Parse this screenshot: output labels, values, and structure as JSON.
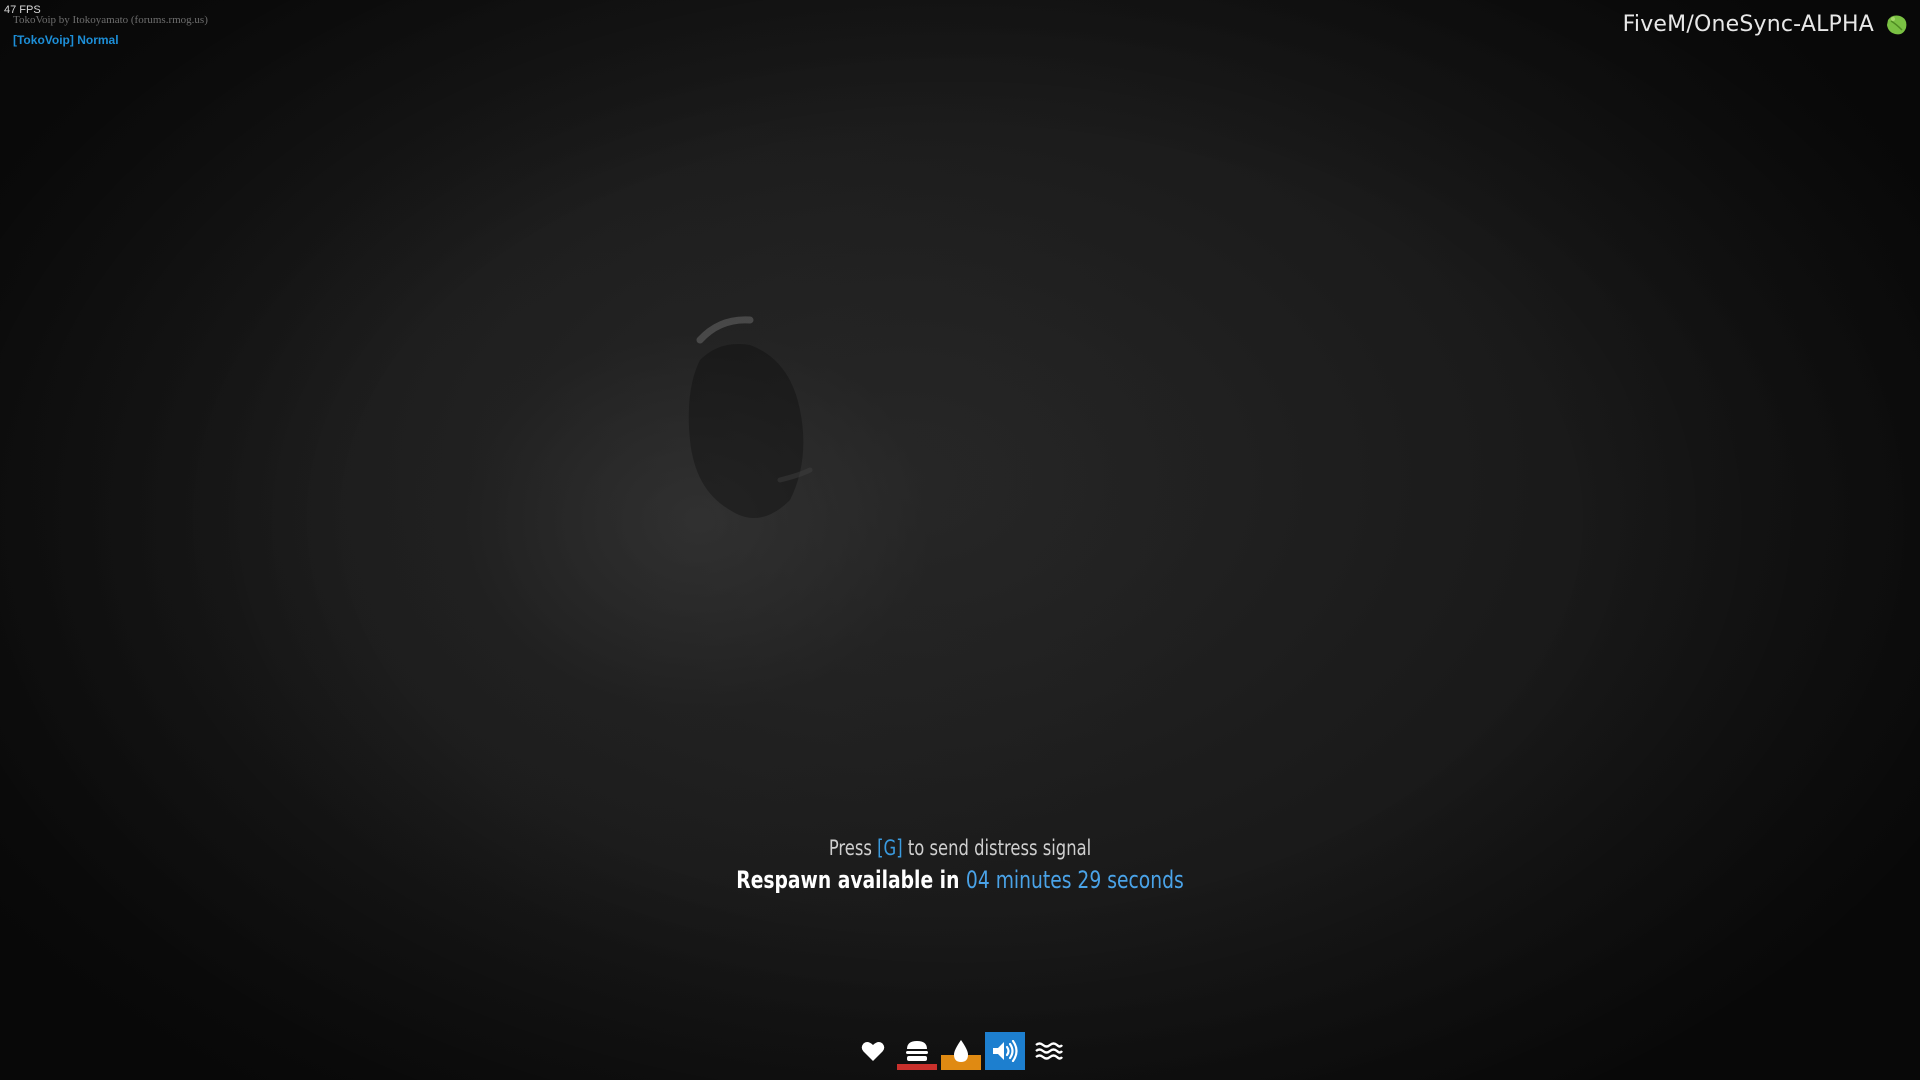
{
  "overlay": {
    "fps": "47 FPS",
    "voip_credit": "TokoVoip by Itokoyamato (forums.rmog.us)",
    "voip_mode": "[TokoVoip] Normal"
  },
  "server": {
    "name": "FiveM/OneSync-ALPHA",
    "logo_icon": "fivem-leaf-logo",
    "logo_color": "#7ac143"
  },
  "death_screen": {
    "distress_prefix": "Press ",
    "distress_key": "[G]",
    "distress_suffix": " to send distress signal",
    "respawn_prefix": "Respawn available in ",
    "respawn_timer": "04 minutes 29 seconds",
    "highlight_color": "#3a9be0"
  },
  "hud": {
    "items": [
      {
        "icon": "heart-icon",
        "level": 0,
        "color": "#d33a2a"
      },
      {
        "icon": "burger-icon",
        "level": 0.15,
        "color": "#c9302c"
      },
      {
        "icon": "water-drop-icon",
        "level": 0.4,
        "color": "#e08a12"
      },
      {
        "icon": "speaker-icon",
        "level": 1.0,
        "color": "#1d7fcf"
      },
      {
        "icon": "wind-waves-icon",
        "level": 0,
        "color": "#888888"
      }
    ]
  }
}
